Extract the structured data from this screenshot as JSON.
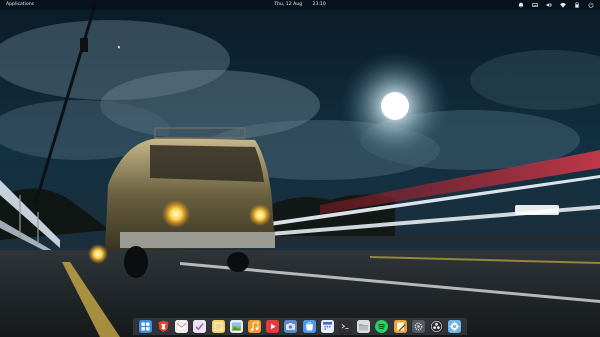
{
  "top_panel": {
    "applications_label": "Applications",
    "date": "Thu, 12 Aug",
    "time": "23:10",
    "indicators": [
      "notifications-icon",
      "keyboard-layout-icon",
      "volume-icon",
      "network-icon",
      "battery-icon",
      "power-icon"
    ]
  },
  "dock": {
    "apps": [
      {
        "icon": "multitasking-view-icon",
        "color": "#3a8ee6"
      },
      {
        "icon": "web-browser-icon",
        "color": "#e0452c"
      },
      {
        "icon": "mail-icon",
        "color": "#f1f1ee"
      },
      {
        "icon": "tasks-icon",
        "color": "#e9e6ef"
      },
      {
        "icon": "notes-icon",
        "color": "#f6d36a"
      },
      {
        "icon": "photos-icon",
        "color": "#eaeaea"
      },
      {
        "icon": "music-icon",
        "color": "#f39a2a"
      },
      {
        "icon": "videos-icon",
        "color": "#e43b3b"
      },
      {
        "icon": "screenshot-icon",
        "color": "#5e88c4"
      },
      {
        "icon": "appcenter-icon",
        "color": "#4d9ae8"
      },
      {
        "icon": "calendar-icon",
        "color": "#e9ecf1"
      },
      {
        "icon": "terminal-icon",
        "color": "#2f2f33"
      },
      {
        "icon": "files-icon",
        "color": "#dcdcdc"
      },
      {
        "icon": "spotify-icon",
        "color": "#1ed760"
      },
      {
        "icon": "text-editor-icon",
        "color": "#e8a23c"
      },
      {
        "icon": "settings-icon",
        "color": "#57595e"
      },
      {
        "icon": "obs-studio-icon",
        "color": "#2b2b2f"
      },
      {
        "icon": "app-store-icon",
        "color": "#6fb4ea"
      }
    ]
  }
}
